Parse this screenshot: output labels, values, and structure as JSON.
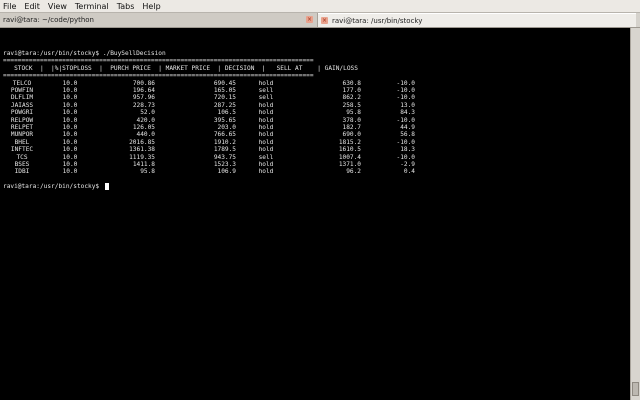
{
  "menubar": [
    "File",
    "Edit",
    "View",
    "Terminal",
    "Tabs",
    "Help"
  ],
  "tabs": [
    {
      "title": "ravi@tara: ~/code/python"
    },
    {
      "title": "ravi@tara: /usr/bin/stocky"
    }
  ],
  "terminal": {
    "prompt_cmd": "ravi@tara:/usr/bin/stocky$ ./BuySellDecision",
    "separator": "====================================================================================",
    "headers": [
      "STOCK",
      "|%|STOPLOSS",
      "PURCH PRICE",
      "MARKET PRICE",
      "DECISION",
      "SELL AT",
      "GAIN/LOSS"
    ],
    "header_line": "   STOCK  |  |%|STOPLOSS  |  PURCH PRICE  | MARKET PRICE  | DECISION  |   SELL AT    | GAIN/LOSS",
    "rows": [
      [
        "TELCO",
        "10.0",
        "700.86",
        "690.45",
        "hold",
        "630.8",
        "-10.0"
      ],
      [
        "POWFIN",
        "10.0",
        "196.64",
        "165.05",
        "sell",
        "177.0",
        "-10.0"
      ],
      [
        "DLFLIM",
        "10.0",
        "957.96",
        "720.15",
        "sell",
        "862.2",
        "-10.0"
      ],
      [
        "JAIASS",
        "10.0",
        "228.73",
        "287.25",
        "hold",
        "258.5",
        "13.0"
      ],
      [
        "POWGRI",
        "10.0",
        "52.0",
        "106.5",
        "hold",
        "95.8",
        "84.3"
      ],
      [
        "RELPOW",
        "10.0",
        "420.0",
        "395.65",
        "hold",
        "378.0",
        "-10.0"
      ],
      [
        "RELPET",
        "10.0",
        "126.05",
        "203.0",
        "hold",
        "182.7",
        "44.9"
      ],
      [
        "MUNPOR",
        "10.0",
        "440.0",
        "766.65",
        "hold",
        "690.0",
        "56.8"
      ],
      [
        "BHEL",
        "10.0",
        "2016.85",
        "1910.2",
        "hold",
        "1815.2",
        "-10.0"
      ],
      [
        "INFTEC",
        "10.0",
        "1361.38",
        "1789.5",
        "hold",
        "1610.5",
        "18.3"
      ],
      [
        "TCS",
        "10.0",
        "1119.35",
        "943.75",
        "sell",
        "1007.4",
        "-10.0"
      ],
      [
        "BSES",
        "10.0",
        "1411.8",
        "1523.3",
        "hold",
        "1371.0",
        "-2.9"
      ],
      [
        "IDBI",
        "10.0",
        "95.8",
        "106.9",
        "hold",
        "96.2",
        "0.4"
      ]
    ],
    "prompt_end": "ravi@tara:/usr/bin/stocky$ "
  }
}
